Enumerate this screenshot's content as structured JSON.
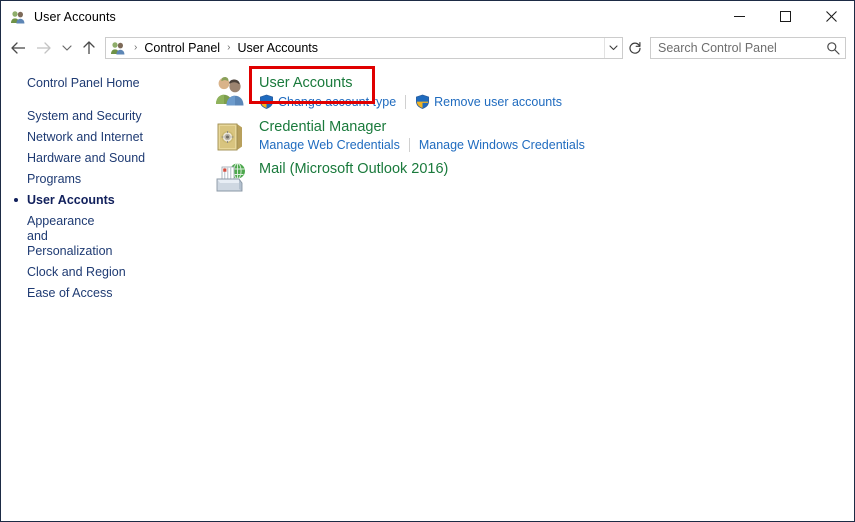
{
  "window": {
    "title": "User Accounts",
    "title_icon": "user-accounts-icon",
    "controls": {
      "minimize": "–",
      "maximize": "□",
      "close": "✕"
    }
  },
  "navbar": {
    "back_icon": "back-arrow-icon",
    "forward_icon": "forward-arrow-icon",
    "recent_icon": "chevron-down-icon",
    "up_icon": "up-arrow-icon",
    "refresh_icon": "refresh-icon",
    "breadcrumb": {
      "icon": "control-panel-user-icon",
      "separator": "›",
      "items": [
        "Control Panel",
        "User Accounts"
      ]
    },
    "dropdown_icon": "chevron-down-icon",
    "search": {
      "placeholder": "Search Control Panel",
      "value": "",
      "icon": "search-icon"
    }
  },
  "sidebar": {
    "home": "Control Panel Home",
    "items": [
      {
        "label": "System and Security",
        "current": false
      },
      {
        "label": "Network and Internet",
        "current": false
      },
      {
        "label": "Hardware and Sound",
        "current": false
      },
      {
        "label": "Programs",
        "current": false
      },
      {
        "label": "User Accounts",
        "current": true
      },
      {
        "label": "Appearance and Personalization",
        "current": false
      },
      {
        "label": "Clock and Region",
        "current": false
      },
      {
        "label": "Ease of Access",
        "current": false
      }
    ]
  },
  "main": {
    "categories": [
      {
        "title": "User Accounts",
        "icon": "user-accounts-icon",
        "links": [
          {
            "label": "Change account type",
            "shield": true
          },
          {
            "label": "Remove user accounts",
            "shield": true
          }
        ]
      },
      {
        "title": "Credential Manager",
        "icon": "credential-vault-icon",
        "links": [
          {
            "label": "Manage Web Credentials",
            "shield": false
          },
          {
            "label": "Manage Windows Credentials",
            "shield": false
          }
        ]
      },
      {
        "title": "Mail (Microsoft Outlook 2016)",
        "icon": "mail-icon",
        "links": []
      }
    ]
  },
  "annotation": {
    "type": "highlight-rectangle",
    "target": "User Accounts",
    "color": "#e00000"
  },
  "colors": {
    "heading_green": "#1a7a3c",
    "link_blue": "#1f6bbf",
    "sidebar_blue": "#1f3b73",
    "sidebar_current": "#11205c",
    "annotation_red": "#e00000",
    "window_border": "#1d2b45"
  }
}
